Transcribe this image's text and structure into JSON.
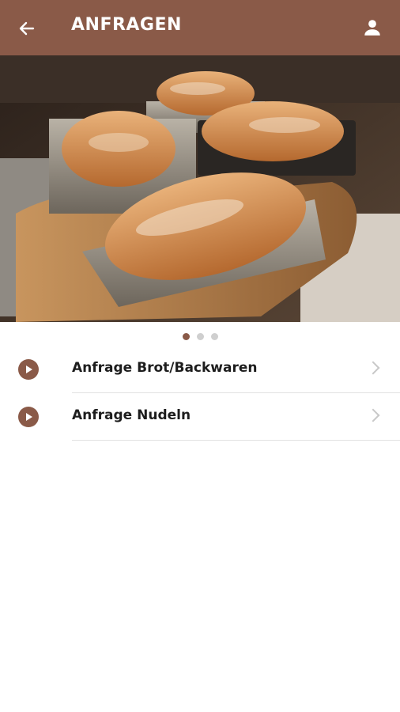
{
  "header": {
    "title": "ANFRAGEN",
    "back_icon": "arrow-left-icon",
    "profile_icon": "user-icon",
    "background_color": "#8a5a48"
  },
  "carousel": {
    "image_subject": "bread-loaves-in-oven",
    "page_count": 3,
    "active_page": 1
  },
  "menu": {
    "items": [
      {
        "label": "Anfrage Brot/Backwaren",
        "icon": "play-circle-icon",
        "trailing_icon": "chevron-right-icon"
      },
      {
        "label": "Anfrage Nudeln",
        "icon": "play-circle-icon",
        "trailing_icon": "chevron-right-icon"
      }
    ]
  },
  "colors": {
    "brand": "#8a5a48",
    "divider": "#e2e2e2",
    "text": "#1d1d1d"
  }
}
